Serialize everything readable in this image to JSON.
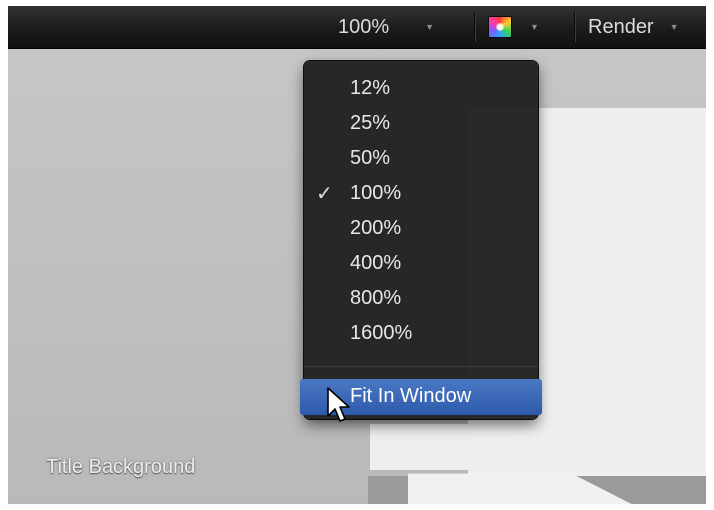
{
  "toolbar": {
    "zoom_value": "100%",
    "render_label": "Render",
    "arrow_glyph": "▼"
  },
  "zoom_menu": {
    "items": [
      {
        "label": "12%",
        "checked": false
      },
      {
        "label": "25%",
        "checked": false
      },
      {
        "label": "50%",
        "checked": false
      },
      {
        "label": "100%",
        "checked": true
      },
      {
        "label": "200%",
        "checked": false
      },
      {
        "label": "400%",
        "checked": false
      },
      {
        "label": "800%",
        "checked": false
      },
      {
        "label": "1600%",
        "checked": false
      }
    ],
    "check_glyph": "✓",
    "fit_label": "Fit In Window"
  },
  "viewer": {
    "caption": "Title Background"
  },
  "colors": {
    "toolbar_bg": "#1b1b1b",
    "menu_bg": "#222222",
    "highlight": "#3a66b8",
    "canvas": "#bebebe"
  },
  "icons": [
    "dropdown-arrow-icon",
    "color-channels-icon",
    "checkmark-icon",
    "mouse-pointer-icon"
  ]
}
